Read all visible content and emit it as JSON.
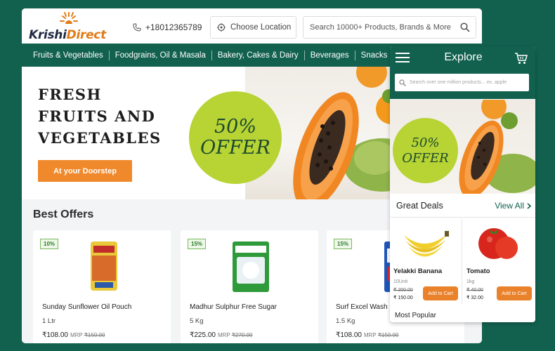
{
  "brand": {
    "name_part1": "Krishi",
    "name_part2": "Direct"
  },
  "header": {
    "phone": "+18012365789",
    "location_label": "Choose Location",
    "search_placeholder": "Search 10000+ Products, Brands & More"
  },
  "nav": {
    "items": [
      "Fruits & Vegetables",
      "Foodgrains, Oil & Masala",
      "Bakery, Cakes & Dairy",
      "Beverages",
      "Snacks"
    ]
  },
  "hero": {
    "title_line1": "FRESH",
    "title_line2": "FRUITS AND",
    "title_line3": "VEGETABLES",
    "button": "At your Doorstep",
    "offer_percent": "50%",
    "offer_word": "OFFER"
  },
  "best_offers": {
    "title": "Best Offers",
    "products": [
      {
        "discount": "10%",
        "name": "Sunday Sunflower Oil Pouch",
        "qty": "1 Ltr",
        "price": "₹108.00",
        "mrp_label": "MRP",
        "mrp": "₹150.00"
      },
      {
        "discount": "15%",
        "name": "Madhur Sulphur Free Sugar",
        "qty": "5 Kg",
        "price": "₹225.00",
        "mrp_label": "MRP",
        "mrp": "₹270.00"
      },
      {
        "discount": "15%",
        "name": "Surf Excel Wash D",
        "qty": "1.5 Kg",
        "price": "₹108.00",
        "mrp_label": "MRP",
        "mrp": "₹150.00"
      }
    ]
  },
  "mobile": {
    "title": "Explore",
    "search_placeholder": "Search over one million products... ex. apple",
    "offer_percent": "50%",
    "offer_word": "OFFER",
    "deals_title": "Great Deals",
    "view_all": "View All",
    "deals": [
      {
        "name": "Yelakki Banana",
        "unit": "10Unit",
        "mrp": "₹ 200.00",
        "price": "₹ 150.00",
        "add": "Add to Cart"
      },
      {
        "name": "Tomato",
        "unit": "1kg",
        "mrp": "₹ 40.00",
        "price": "₹ 32.00",
        "add": "Add to Cart"
      }
    ],
    "popular_title": "Most Popular"
  },
  "colors": {
    "brand_green": "#12614f",
    "accent_orange": "#f0892b",
    "offer_lime": "#b7d334"
  }
}
